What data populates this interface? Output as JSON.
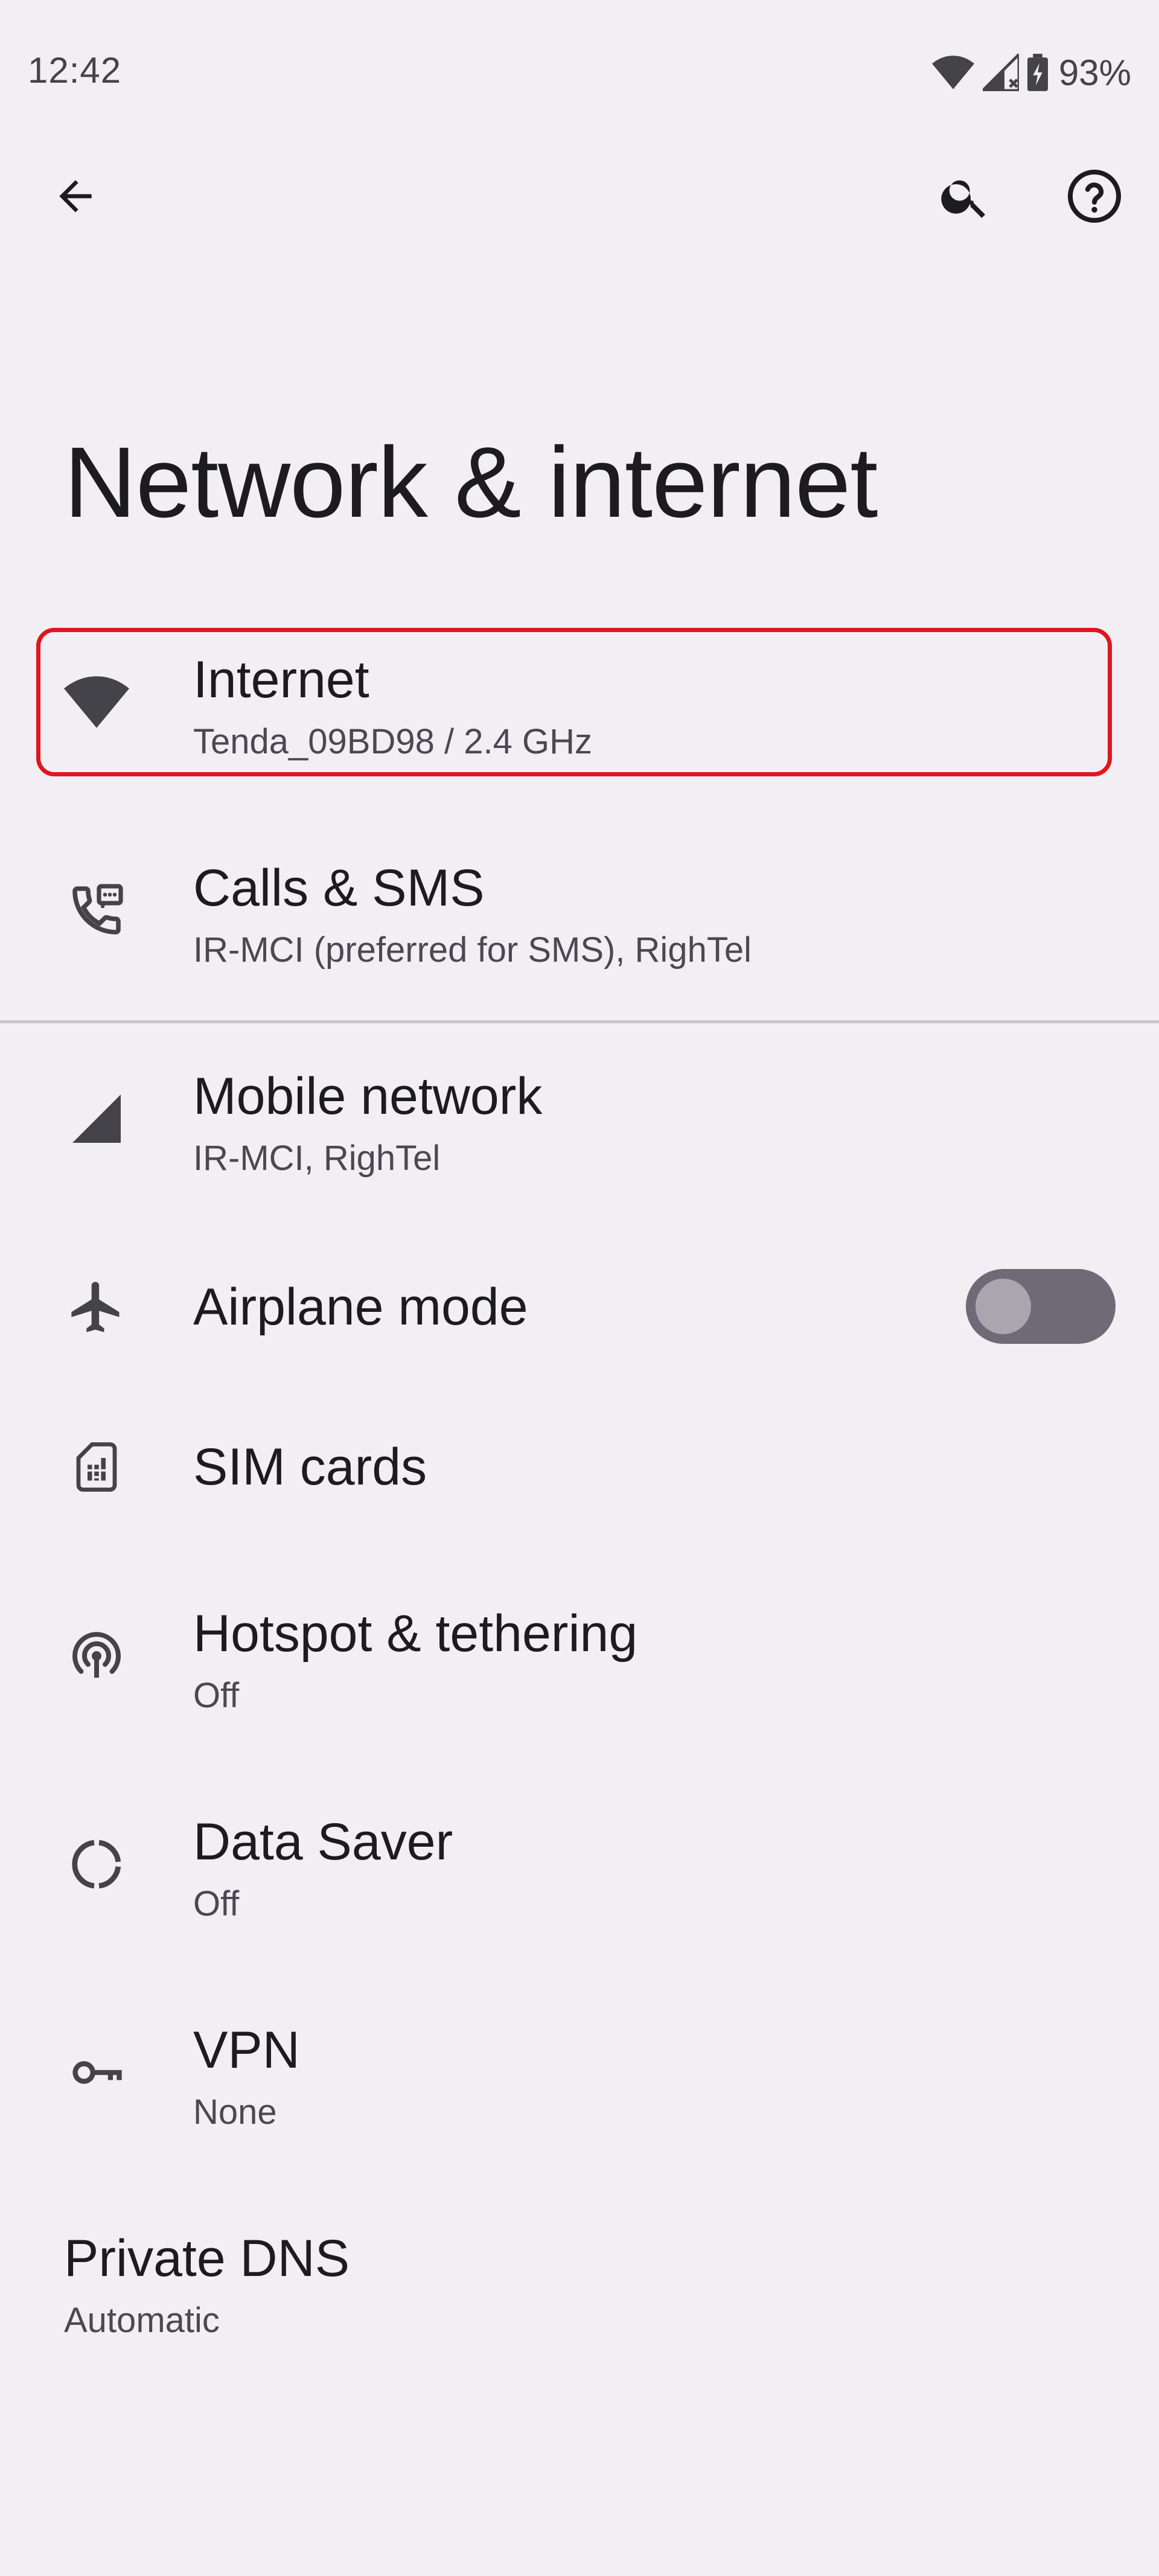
{
  "status_bar": {
    "time": "12:42",
    "battery": "93%",
    "icons": [
      "wifi-icon",
      "cell-signal-icon",
      "battery-charging-icon"
    ]
  },
  "app_bar": {
    "icons": [
      "back-arrow-icon",
      "search-icon",
      "help-icon"
    ]
  },
  "page": {
    "title": "Network & internet"
  },
  "items": [
    {
      "title": "Internet",
      "subtitle": "Tenda_09BD98 / 2.4 GHz",
      "icon": "wifi-icon"
    },
    {
      "title": "Calls & SMS",
      "subtitle": "IR-MCI (preferred for SMS), RighTel",
      "icon": "phone-sms-icon"
    },
    {
      "title": "Mobile network",
      "subtitle": "IR-MCI, RighTel",
      "icon": "signal-icon"
    },
    {
      "title": "Airplane mode",
      "subtitle": "",
      "icon": "airplane-icon",
      "toggle": false
    },
    {
      "title": "SIM cards",
      "subtitle": "",
      "icon": "sim-card-icon"
    },
    {
      "title": "Hotspot & tethering",
      "subtitle": "Off",
      "icon": "hotspot-icon"
    },
    {
      "title": "Data Saver",
      "subtitle": "Off",
      "icon": "data-saver-icon"
    },
    {
      "title": "VPN",
      "subtitle": "None",
      "icon": "vpn-key-icon"
    },
    {
      "title": "Private DNS",
      "subtitle": "Automatic",
      "icon": ""
    }
  ],
  "colors": {
    "background": "#F2EFF4",
    "highlight": "#E0161B",
    "icon": "#44434A",
    "toggle_track": "#6E6B77"
  }
}
